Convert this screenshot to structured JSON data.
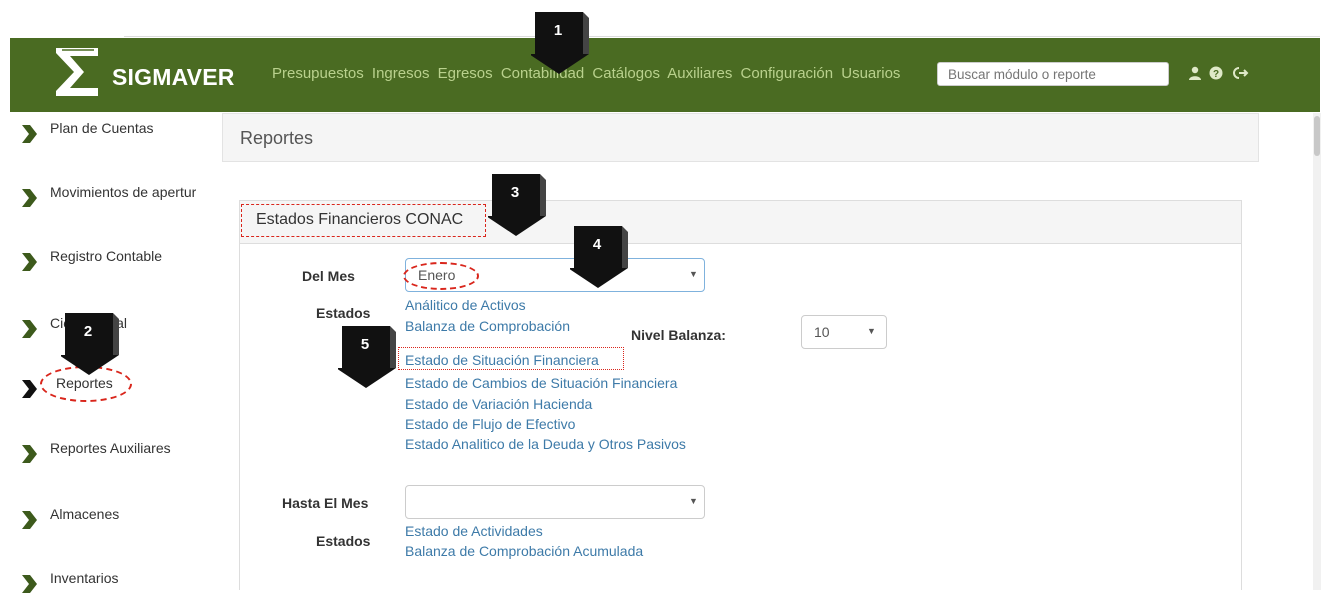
{
  "app": {
    "name": "SIGMAVER"
  },
  "nav": {
    "items": [
      "Presupuestos",
      "Ingresos",
      "Egresos",
      "Contabilidad",
      "Catálogos",
      "Auxiliares",
      "Configuración",
      "Usuarios"
    ],
    "search_placeholder": "Buscar módulo o reporte",
    "icons": [
      "user-icon",
      "help-icon",
      "logout-icon"
    ]
  },
  "sidebar": {
    "items": [
      {
        "label": "Plan de Cuentas"
      },
      {
        "label": "Movimientos de apertura"
      },
      {
        "label": "Registro Contable"
      },
      {
        "label": "Cierre Anual"
      },
      {
        "label": "Reportes"
      },
      {
        "label": "Reportes Auxiliares"
      },
      {
        "label": "Almacenes"
      },
      {
        "label": "Inventarios"
      }
    ]
  },
  "page": {
    "title": "Reportes"
  },
  "panel": {
    "title": "Estados Financieros CONAC",
    "del_mes_label": "Del Mes",
    "del_mes_value": "Enero",
    "estados_label": "Estados",
    "estados_links": [
      "Análitico de Activos",
      "Balanza de Comprobación",
      "Estado de Situación Financiera",
      "Estado de Cambios de Situación Financiera",
      "Estado de Variación Hacienda",
      "Estado de Flujo de Efectivo",
      "Estado Analitico de la Deuda y Otros Pasivos"
    ],
    "nivel_label": "Nivel Balanza:",
    "nivel_value": "10",
    "hasta_label": "Hasta El Mes",
    "hasta_value": "",
    "estados2_label": "Estados",
    "estados2_links": [
      "Estado de Actividades",
      "Balanza de Comprobación Acumulada"
    ]
  },
  "annotations": {
    "markers": [
      "1",
      "2",
      "3",
      "4",
      "5"
    ],
    "color": "#d9261c"
  },
  "colors": {
    "navbar": "#4a6b22",
    "nav_text": "#b9d18d",
    "link": "#3d7aa8"
  }
}
